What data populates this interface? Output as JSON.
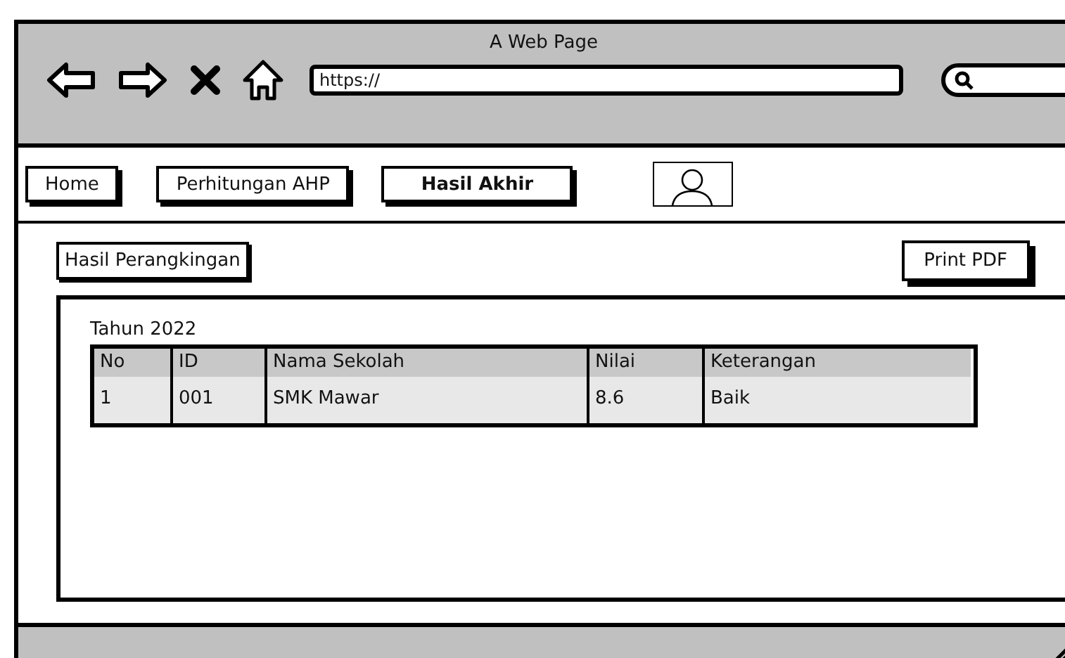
{
  "window": {
    "title": "A Web Page",
    "url": "https://"
  },
  "tabs": [
    {
      "label": "Home",
      "selected": false
    },
    {
      "label": "Perhitungan AHP",
      "selected": false
    },
    {
      "label": "Hasil Akhir",
      "selected": true
    }
  ],
  "section_label": "Hasil Perangkingan",
  "print_button": "Print PDF",
  "year_label": "Tahun 2022",
  "table": {
    "columns": [
      "No",
      "ID",
      "Nama Sekolah",
      "Nilai",
      "Keterangan"
    ],
    "rows": [
      [
        "1",
        "001",
        "SMK Mawar",
        "8.6",
        "Baik"
      ]
    ]
  }
}
